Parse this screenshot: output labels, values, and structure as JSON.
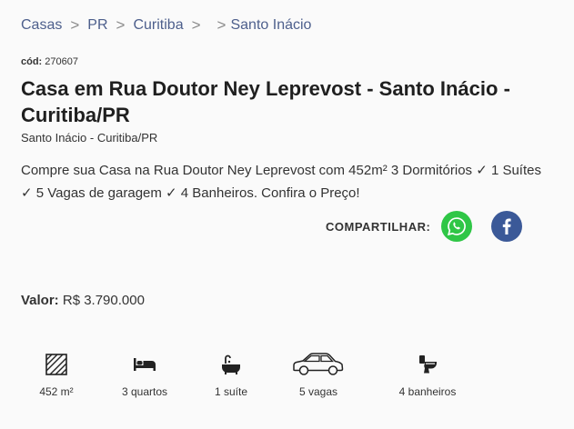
{
  "breadcrumb": {
    "items": [
      "Casas",
      "PR",
      "Curitiba",
      "Santo Inácio"
    ],
    "separator": ">"
  },
  "code": {
    "label": "cód:",
    "value": "270607"
  },
  "title": "Casa em Rua Doutor Ney Leprevost - Santo Inácio - Curitiba/PR",
  "location": "Santo Inácio - Curitiba/PR",
  "description": "Compre sua Casa na Rua Doutor Ney Leprevost com 452m² 3 Dormitórios ✓ 1 Suítes ✓ 5 Vagas de garagem ✓ 4 Banheiros. Confira o Preço!",
  "share": {
    "label": "COMPARTILHAR:",
    "whatsapp_icon": "whatsapp-icon",
    "facebook_icon": "facebook-icon",
    "whatsapp_color": "#2fc646",
    "facebook_color": "#3b5998"
  },
  "price": {
    "label": "Valor:",
    "value": "R$ 3.790.000"
  },
  "features": [
    {
      "icon": "area-icon",
      "label": "452 m²"
    },
    {
      "icon": "bed-icon",
      "label": "3 quartos"
    },
    {
      "icon": "bathtub-icon",
      "label": "1 suíte"
    },
    {
      "icon": "car-icon",
      "label": "5 vagas"
    },
    {
      "icon": "toilet-icon",
      "label": "4 banheiros"
    }
  ],
  "colors": {
    "breadcrumb": "#4d5f8c",
    "text": "#212121",
    "background": "#fafafa"
  }
}
